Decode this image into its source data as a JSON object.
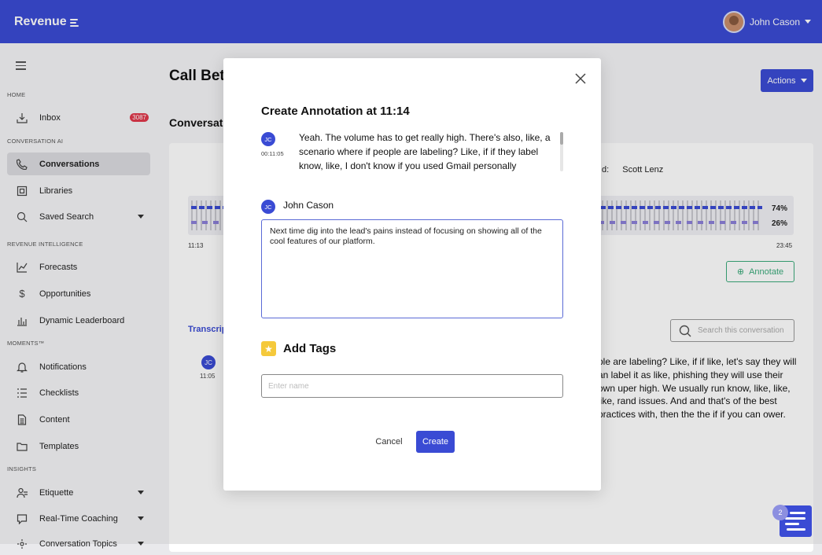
{
  "app": {
    "brand": "Revenue"
  },
  "user": {
    "name": "John Cason"
  },
  "sidebar": {
    "sections": {
      "home": "HOME",
      "conversation_ai": "CONVERSATION AI",
      "revenue_intelligence": "REVENUE INTELLIGENCE",
      "moments": "MOMENTS™",
      "insights": "INSIGHTS"
    },
    "items": {
      "inbox": {
        "label": "Inbox",
        "badge": "3087"
      },
      "conversations": {
        "label": "Conversations"
      },
      "libraries": {
        "label": "Libraries"
      },
      "saved_search": {
        "label": "Saved Search"
      },
      "forecasts": {
        "label": "Forecasts"
      },
      "opportunities": {
        "label": "Opportunities"
      },
      "dynamic_leaderboard": {
        "label": "Dynamic Leaderboard"
      },
      "notifications": {
        "label": "Notifications"
      },
      "checklists": {
        "label": "Checklists"
      },
      "content": {
        "label": "Content"
      },
      "templates": {
        "label": "Templates"
      },
      "etiquette": {
        "label": "Etiquette"
      },
      "realtime_coaching": {
        "label": "Real-Time Coaching"
      },
      "conversation_topics": {
        "label": "Conversation Topics"
      }
    }
  },
  "main": {
    "title": "Call Betw",
    "subtitle": "Conversat",
    "actions_label": "Actions",
    "lead_label": "d:",
    "lead_name": "Scott Lenz",
    "pct_top": "74%",
    "pct_bottom": "26%",
    "time_start": "11:13",
    "time_end": "23:45",
    "annotate_label": "Annotate",
    "transcript_tab": "Transcript",
    "search_placeholder": "Search this conversation",
    "jc_initials": "JC",
    "jc_time": "11:05",
    "transcript_visible": "ple are labeling? Like, if if like, let's say they will an label it as like, phishing they will use their own uper high. We usually run know, like, like, like, rand issues. And and that's of the best practices with, then the the if if you can ower."
  },
  "modal": {
    "title": "Create Annotation at 11:14",
    "quote_initials": "JC",
    "quote_timestamp": "00:11:05",
    "quote_text": "Yeah. The volume has to get really high. There's also, like, a scenario where if people are labeling? Like, if if they label know, like, I don't know if you used Gmail personally",
    "author_initials": "JC",
    "author_name": "John Cason",
    "annotation_text": "Next time dig into the lead's pains instead of focusing on showing all of the cool features of our platform.",
    "tags_title": "Add Tags",
    "tags_placeholder": "Enter name",
    "cancel_label": "Cancel",
    "create_label": "Create"
  },
  "chat": {
    "count": "2"
  },
  "colors": {
    "primary": "#3a4bd4",
    "annotate": "#3aaa7a",
    "badge": "#e0384b",
    "star": "#f5c93b"
  }
}
